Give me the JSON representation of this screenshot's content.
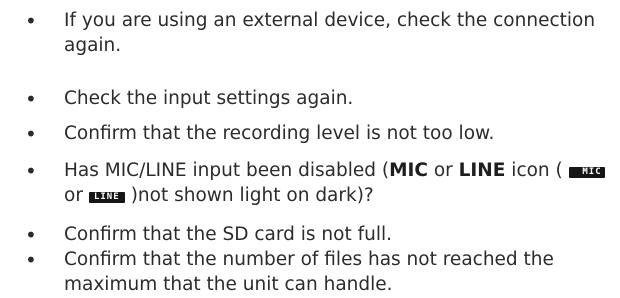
{
  "bullet_symbol": "•",
  "items": [
    {
      "line1": "If you are using an external device, check the connection",
      "line2": "again."
    },
    {
      "line1": "Check the input settings again."
    },
    {
      "line1": "Confirm that the recording level is not too low."
    },
    {
      "line1_pre": "Has MIC/LINE input been disabled (",
      "mic_bold": "MIC",
      "or_1": " or ",
      "line_bold": "LINE",
      "icon_open": " icon ( ",
      "mic_icon_text": "MIC",
      "or_2": "or ",
      "line_icon_text": "LINE",
      "line2_post": " )not shown light on dark)?"
    },
    {
      "line1": "Confirm that the SD card is not full."
    },
    {
      "line1": "Confirm that the number of files has not reached the",
      "line2": "maximum that the unit can handle."
    }
  ]
}
